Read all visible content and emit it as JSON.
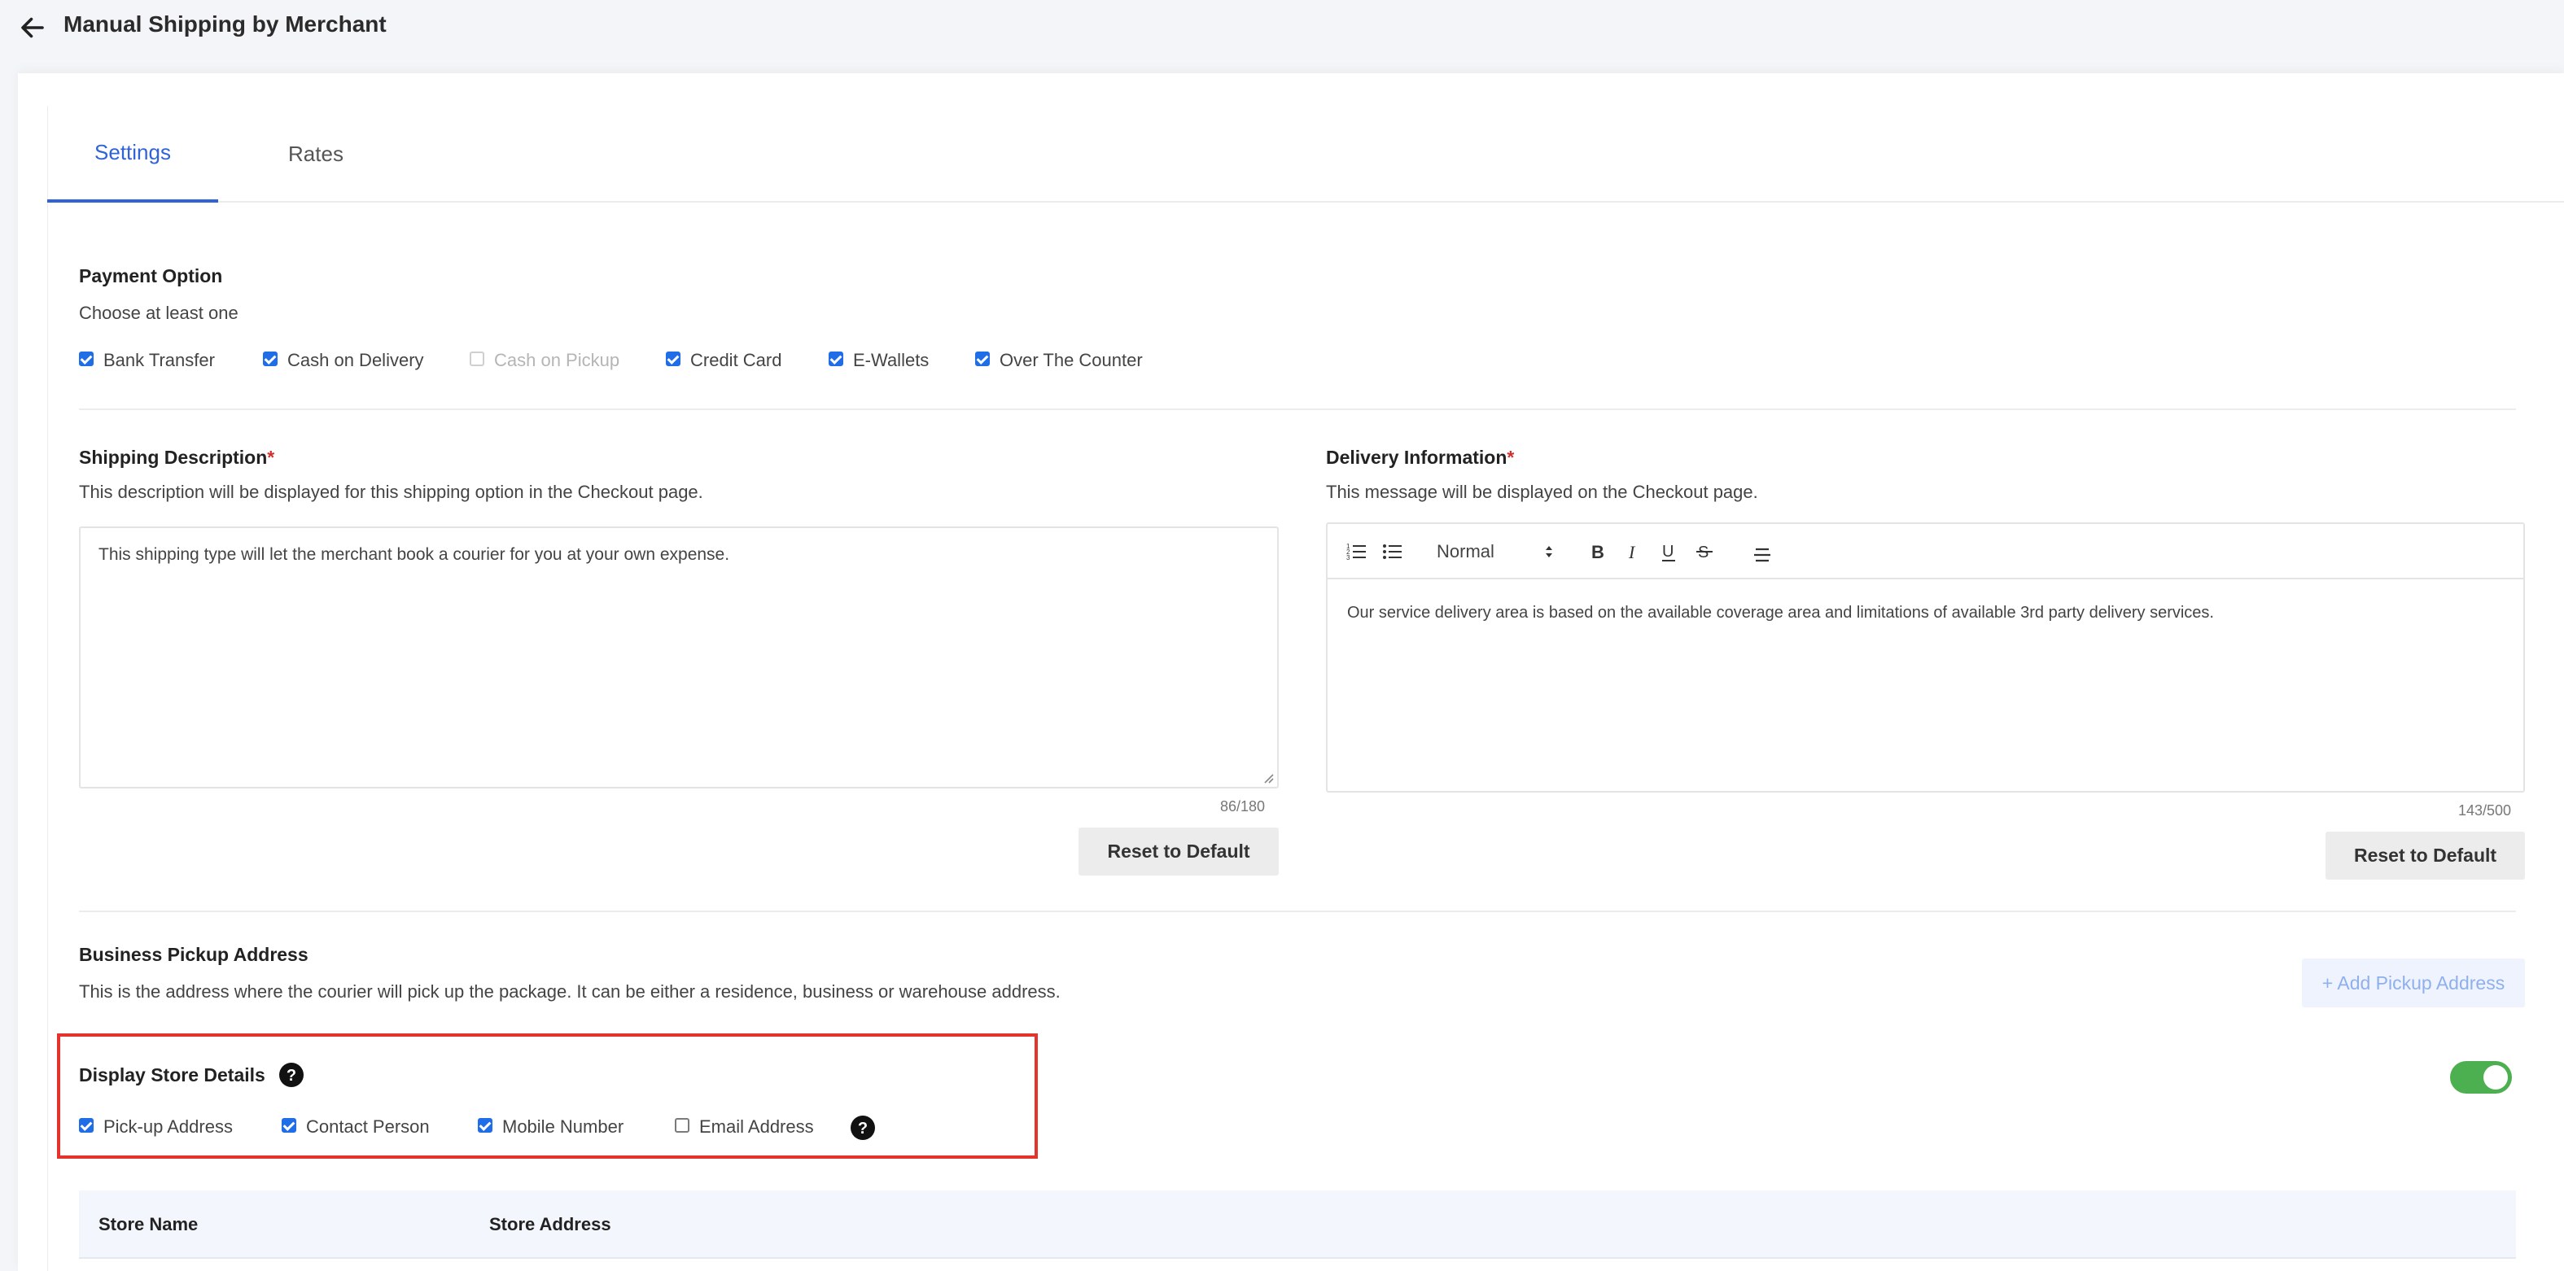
{
  "header": {
    "title": "Manual Shipping by Merchant",
    "back_icon": "arrow-left-icon"
  },
  "tabs": [
    {
      "label": "Settings",
      "active": true
    },
    {
      "label": "Rates",
      "active": false
    }
  ],
  "payment_option": {
    "title": "Payment Option",
    "subtitle": "Choose at least one",
    "options": [
      {
        "label": "Bank Transfer",
        "checked": true,
        "disabled": false
      },
      {
        "label": "Cash on Delivery",
        "checked": true,
        "disabled": false
      },
      {
        "label": "Cash on Pickup",
        "checked": false,
        "disabled": true
      },
      {
        "label": "Credit Card",
        "checked": true,
        "disabled": false
      },
      {
        "label": "E-Wallets",
        "checked": true,
        "disabled": false
      },
      {
        "label": "Over The Counter",
        "checked": true,
        "disabled": false
      }
    ]
  },
  "shipping_description": {
    "title": "Shipping Description",
    "required_mark": "*",
    "subtitle": "This description will be displayed for this shipping option in the Checkout page.",
    "value": "This shipping type will let the merchant book a courier for you at your own expense.",
    "counter": "86/180",
    "reset_label": "Reset to Default"
  },
  "delivery_information": {
    "title": "Delivery Information",
    "required_mark": "*",
    "subtitle": "This message will be displayed on the Checkout page.",
    "toolbar": {
      "format_value": "Normal",
      "icons": [
        "ordered-list-icon",
        "bullet-list-icon",
        "bold-icon",
        "italic-icon",
        "underline-icon",
        "strikethrough-icon",
        "align-icon"
      ]
    },
    "value": "Our service delivery area is based on the available coverage area and limitations of available 3rd party delivery services.",
    "counter": "143/500",
    "reset_label": "Reset to Default"
  },
  "business_pickup": {
    "title": "Business Pickup Address",
    "subtitle": "This is the address where the courier will pick up the package. It can be either a residence, business or warehouse address.",
    "add_label": "+ Add Pickup Address"
  },
  "display_store_details": {
    "title": "Display Store Details",
    "toggle_on": true,
    "options": [
      {
        "label": "Pick-up Address",
        "checked": true
      },
      {
        "label": "Contact Person",
        "checked": true
      },
      {
        "label": "Mobile Number",
        "checked": true
      },
      {
        "label": "Email Address",
        "checked": false
      }
    ],
    "highlight_color": "#e3332a"
  },
  "store_table": {
    "columns": [
      "Store Name",
      "Store Address"
    ]
  },
  "colors": {
    "accent": "#2f63d6",
    "checkbox": "#1f6ee8",
    "toggle": "#4caf50",
    "required": "#d0312d"
  }
}
